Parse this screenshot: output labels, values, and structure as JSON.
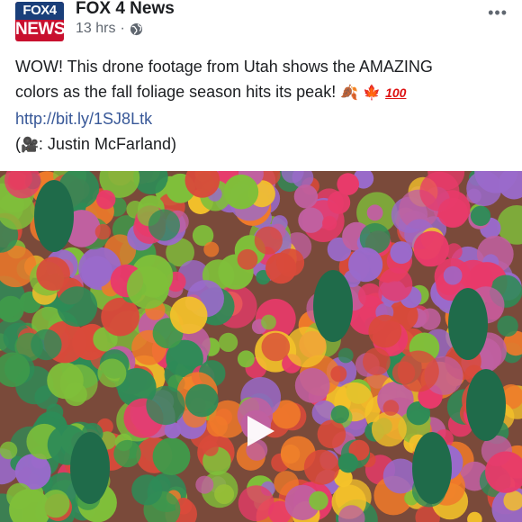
{
  "post": {
    "page_name": "FOX 4 News",
    "avatar_top": "FOX4",
    "avatar_bottom": "NEWS",
    "timestamp": "13 hrs",
    "separator": "·",
    "privacy_icon": "globe-icon",
    "more_label": "•••",
    "text_line1": "WOW! This drone footage from Utah shows the AMAZING",
    "text_line2": "colors as the fall foliage season hits its peak!",
    "emoji_leaves": "🍂",
    "emoji_maple": "🍁",
    "emoji_100": "100",
    "link": "http://bit.ly/1SJ8Ltk",
    "credit_open": "(",
    "credit_icon": "🎥",
    "credit_text": ": Justin McFarland)"
  },
  "video": {
    "play_icon": "play-icon",
    "subject": "aerial fall foliage",
    "colors": [
      "#e83a6a",
      "#f4c22a",
      "#2e8b57",
      "#f07a2a",
      "#c060a0",
      "#7fbf3a",
      "#d94a3a",
      "#9a6acb"
    ]
  }
}
